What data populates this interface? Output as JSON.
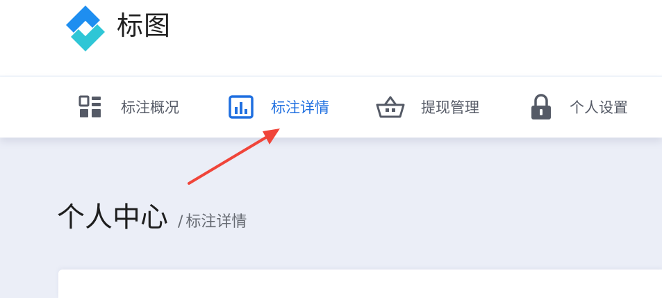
{
  "app": {
    "title": "标图",
    "logo_icon": "diamond-logo-icon",
    "brand_colors": [
      "#1e8ef0",
      "#2fc6d6"
    ]
  },
  "nav": {
    "active_color": "#1f6fe0",
    "items": [
      {
        "label": "标注概况",
        "icon": "grid-dashboard-icon",
        "active": false
      },
      {
        "label": "标注详情",
        "icon": "bar-chart-icon",
        "active": true
      },
      {
        "label": "提现管理",
        "icon": "basket-icon",
        "active": false
      },
      {
        "label": "个人设置",
        "icon": "lock-icon",
        "active": false
      }
    ]
  },
  "annotation": {
    "icon": "red-arrow-icon",
    "color": "#f0453a"
  },
  "breadcrumb": {
    "title": "个人中心",
    "separator": "/",
    "current": "标注详情"
  }
}
